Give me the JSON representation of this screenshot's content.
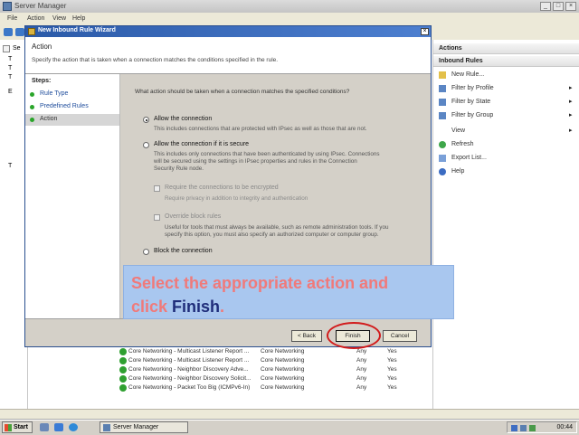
{
  "server_manager": {
    "title": "Server Manager",
    "menu": [
      "File",
      "Action",
      "View",
      "Help"
    ],
    "window_buttons": [
      "_",
      "□",
      "×"
    ]
  },
  "tree": {
    "labels": [
      "Se",
      "T",
      "T",
      "T",
      "E",
      "T"
    ]
  },
  "actions": {
    "header": "Actions",
    "section": "Inbound Rules",
    "items": [
      {
        "label": "New Rule...",
        "icon": "new-rule-icon",
        "has_arrow": false
      },
      {
        "label": "Filter by Profile",
        "icon": "filter-icon",
        "has_arrow": true
      },
      {
        "label": "Filter by State",
        "icon": "filter-icon",
        "has_arrow": true
      },
      {
        "label": "Filter by Group",
        "icon": "filter-icon",
        "has_arrow": true
      },
      {
        "label": "View",
        "icon": "none",
        "has_arrow": true
      },
      {
        "label": "Refresh",
        "icon": "refresh-icon",
        "has_arrow": false
      },
      {
        "label": "Export List...",
        "icon": "export-icon",
        "has_arrow": false
      },
      {
        "label": "Help",
        "icon": "help-icon",
        "has_arrow": false
      }
    ]
  },
  "rules": [
    {
      "name": "Core Networking - Multicast Listener Report ...",
      "group": "Core Networking",
      "profile": "Any",
      "enabled": "Yes"
    },
    {
      "name": "Core Networking - Multicast Listener Report ...",
      "group": "Core Networking",
      "profile": "Any",
      "enabled": "Yes"
    },
    {
      "name": "Core Networking - Neighbor Discovery Adve...",
      "group": "Core Networking",
      "profile": "Any",
      "enabled": "Yes"
    },
    {
      "name": "Core Networking - Neighbor Discovery Solicit...",
      "group": "Core Networking",
      "profile": "Any",
      "enabled": "Yes"
    },
    {
      "name": "Core Networking - Packet Too Big (ICMPv6-In)",
      "group": "Core Networking",
      "profile": "Any",
      "enabled": "Yes"
    }
  ],
  "wizard": {
    "title": "New Inbound Rule Wizard",
    "close": "×",
    "header_title": "Action",
    "header_desc": "Specify the action that is taken when a connection matches the conditions specified in the rule.",
    "steps_header": "Steps:",
    "steps": [
      "Rule Type",
      "Predefined Rules",
      "Action"
    ],
    "question": "What action should be taken when a connection matches the specified conditions?",
    "options": {
      "allow": {
        "label": "Allow the connection",
        "desc": "This includes connections that are protected with IPsec as well as those that are not."
      },
      "secure": {
        "label": "Allow the connection if it is secure",
        "desc1": "This includes only connections that have been authenticated by using IPsec. Connections",
        "desc2": "will be secured using the settings in IPsec properties and rules in the Connection",
        "desc3": "Security Rule node."
      },
      "require_encrypt": {
        "label": "Require the connections to be encrypted",
        "desc": "Require privacy in addition to integrity and authentication"
      },
      "override": {
        "label": "Override block rules",
        "desc1": "Useful for tools that must always be available, such as remote administration tools. If you",
        "desc2": "specify this option, you must also specify an authorized computer or computer group."
      },
      "block": {
        "label": "Block the connection"
      }
    },
    "buttons": {
      "back": "< Back",
      "finish": "Finish",
      "cancel": "Cancel"
    }
  },
  "tutorial": {
    "line1": "Select the appropriate action and",
    "line2_prefix": "click ",
    "line2_emph": "Finish",
    "line2_suffix": "."
  },
  "taskbar": {
    "start": "Start",
    "task": "Server Manager",
    "clock": "00:44"
  },
  "colors": {
    "callout_bg": "#a9c7ef",
    "callout_text": "#f07a7a",
    "callout_emph": "#1f2d7a",
    "highlight": "#d21b1b",
    "title_blue": "#2b5aa8"
  }
}
